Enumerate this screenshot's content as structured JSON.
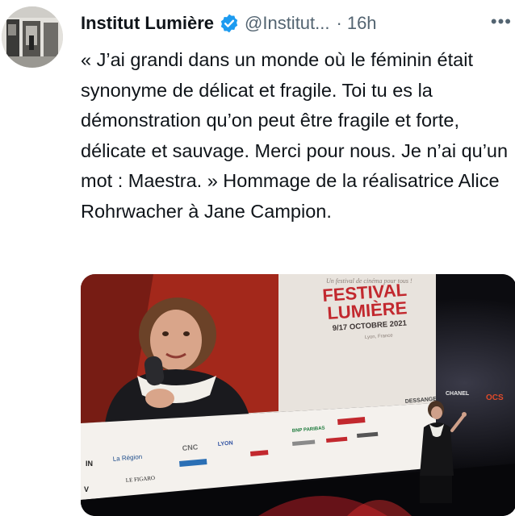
{
  "tweet": {
    "author_name": "Institut Lumière",
    "handle": "@Institut...",
    "separator": "·",
    "time": "16h",
    "more": "•••",
    "text": "« J’ai grandi dans un monde où le féminin était synonyme de délicat et fragile. Toi tu es la démonstration qu’on peut être fragile et forte, délicate et sauvage. Merci pour nous. Je n’ai qu’un mot : Maestra. » Hommage de la réalisatrice Alice Rohrwacher à Jane Campion."
  },
  "media": {
    "screen": {
      "tagline": "Un festival de cinéma pour tous !",
      "title_line1": "FESTIVAL",
      "title_line2": "LUMIÈRE",
      "dates": "9/17 OCTOBRE 2021",
      "location": "Lyon, France"
    },
    "sponsors": {
      "region": "La Région",
      "figaro": "LE FIGARO",
      "cnc": "CNC",
      "lyon": "LYON",
      "bnp": "BNP PARIBAS",
      "ocs": "OCS",
      "chanel": "CHANEL",
      "dessange": "DESSANGE",
      "partial_in": "IN",
      "partial_v": "V"
    },
    "colors": {
      "festival_red": "#c2282e",
      "screen_bg": "#e8e3dd"
    }
  }
}
